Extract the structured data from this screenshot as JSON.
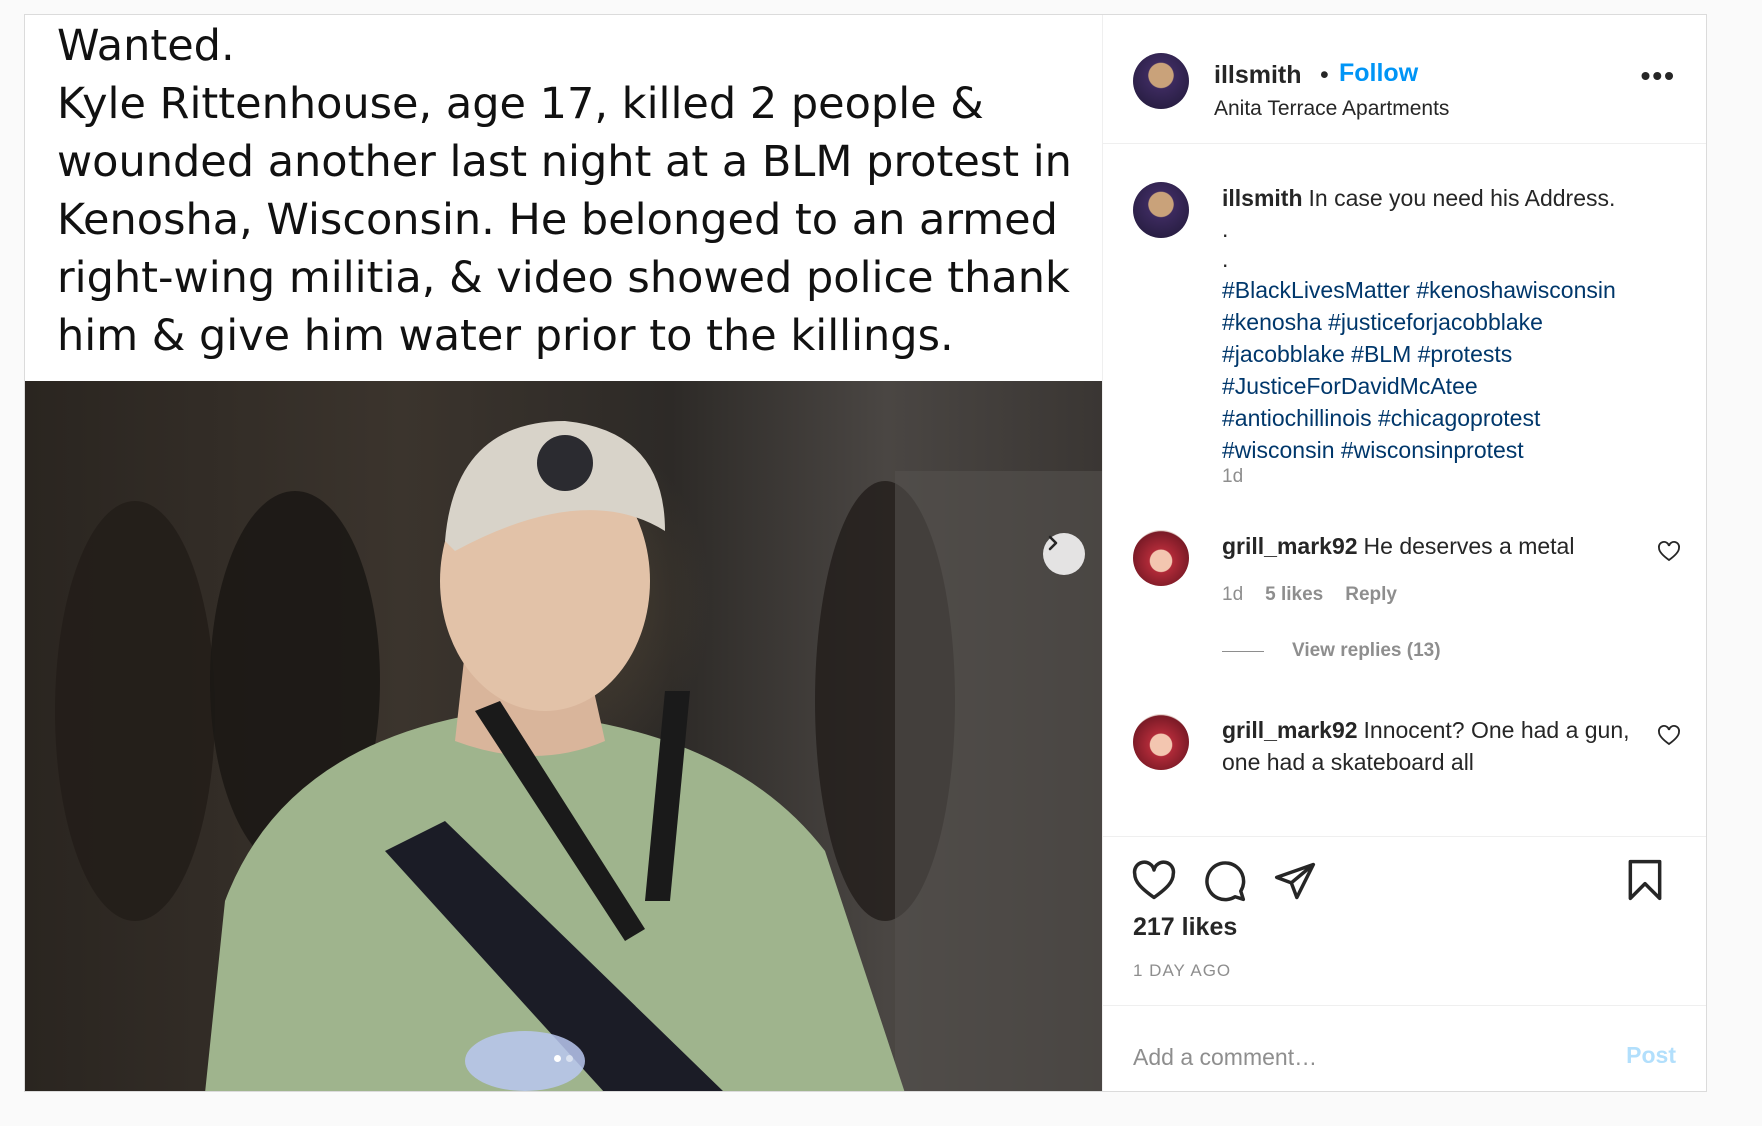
{
  "media": {
    "caption_text": "Wanted.\nKyle Rittenhouse, age 17, killed 2 people &\nwounded another last night at a BLM protest in\nKenosha, Wisconsin. He belonged to an armed\nright-wing militia, & video showed police thank\nhim & give him water prior to the killings.",
    "next_icon": "chevron-right-icon",
    "carousel_dots": 2,
    "carousel_active": 1
  },
  "header": {
    "username": "illsmith",
    "separator": "•",
    "follow_label": "Follow",
    "location": "Anita Terrace Apartments",
    "more_icon": "more-horizontal-icon"
  },
  "caption": {
    "username": "illsmith",
    "text": "In case you need his Address.",
    "dot_lines": [
      ".",
      "."
    ],
    "hashtags": [
      "#BlackLivesMatter",
      "#kenoshawisconsin",
      "#kenosha",
      "#justiceforjacobblake",
      "#jacobblake",
      "#BLM",
      "#protests",
      "#JusticeForDavidMcAtee",
      "#antiochillinois",
      "#chicagoprotest",
      "#wisconsin",
      "#wisconsinprotest"
    ],
    "time": "1d"
  },
  "comments": [
    {
      "username": "grill_mark92",
      "text": "He deserves a metal",
      "time": "1d",
      "likes": "5 likes",
      "reply_label": "Reply",
      "view_replies": "View replies (13)"
    },
    {
      "username": "grill_mark92",
      "text": "Innocent? One had a gun, one had a skateboard all"
    }
  ],
  "actions": {
    "icons": [
      "heart-icon",
      "comment-icon",
      "share-icon",
      "bookmark-icon"
    ],
    "likes": "217 likes",
    "ago": "1 DAY AGO"
  },
  "add_comment": {
    "placeholder": "Add a comment…",
    "post_label": "Post"
  },
  "colors": {
    "accent": "#0095f6",
    "hashtag": "#00376b",
    "muted": "#8e8e8e",
    "post_disabled": "#b2dffc"
  }
}
